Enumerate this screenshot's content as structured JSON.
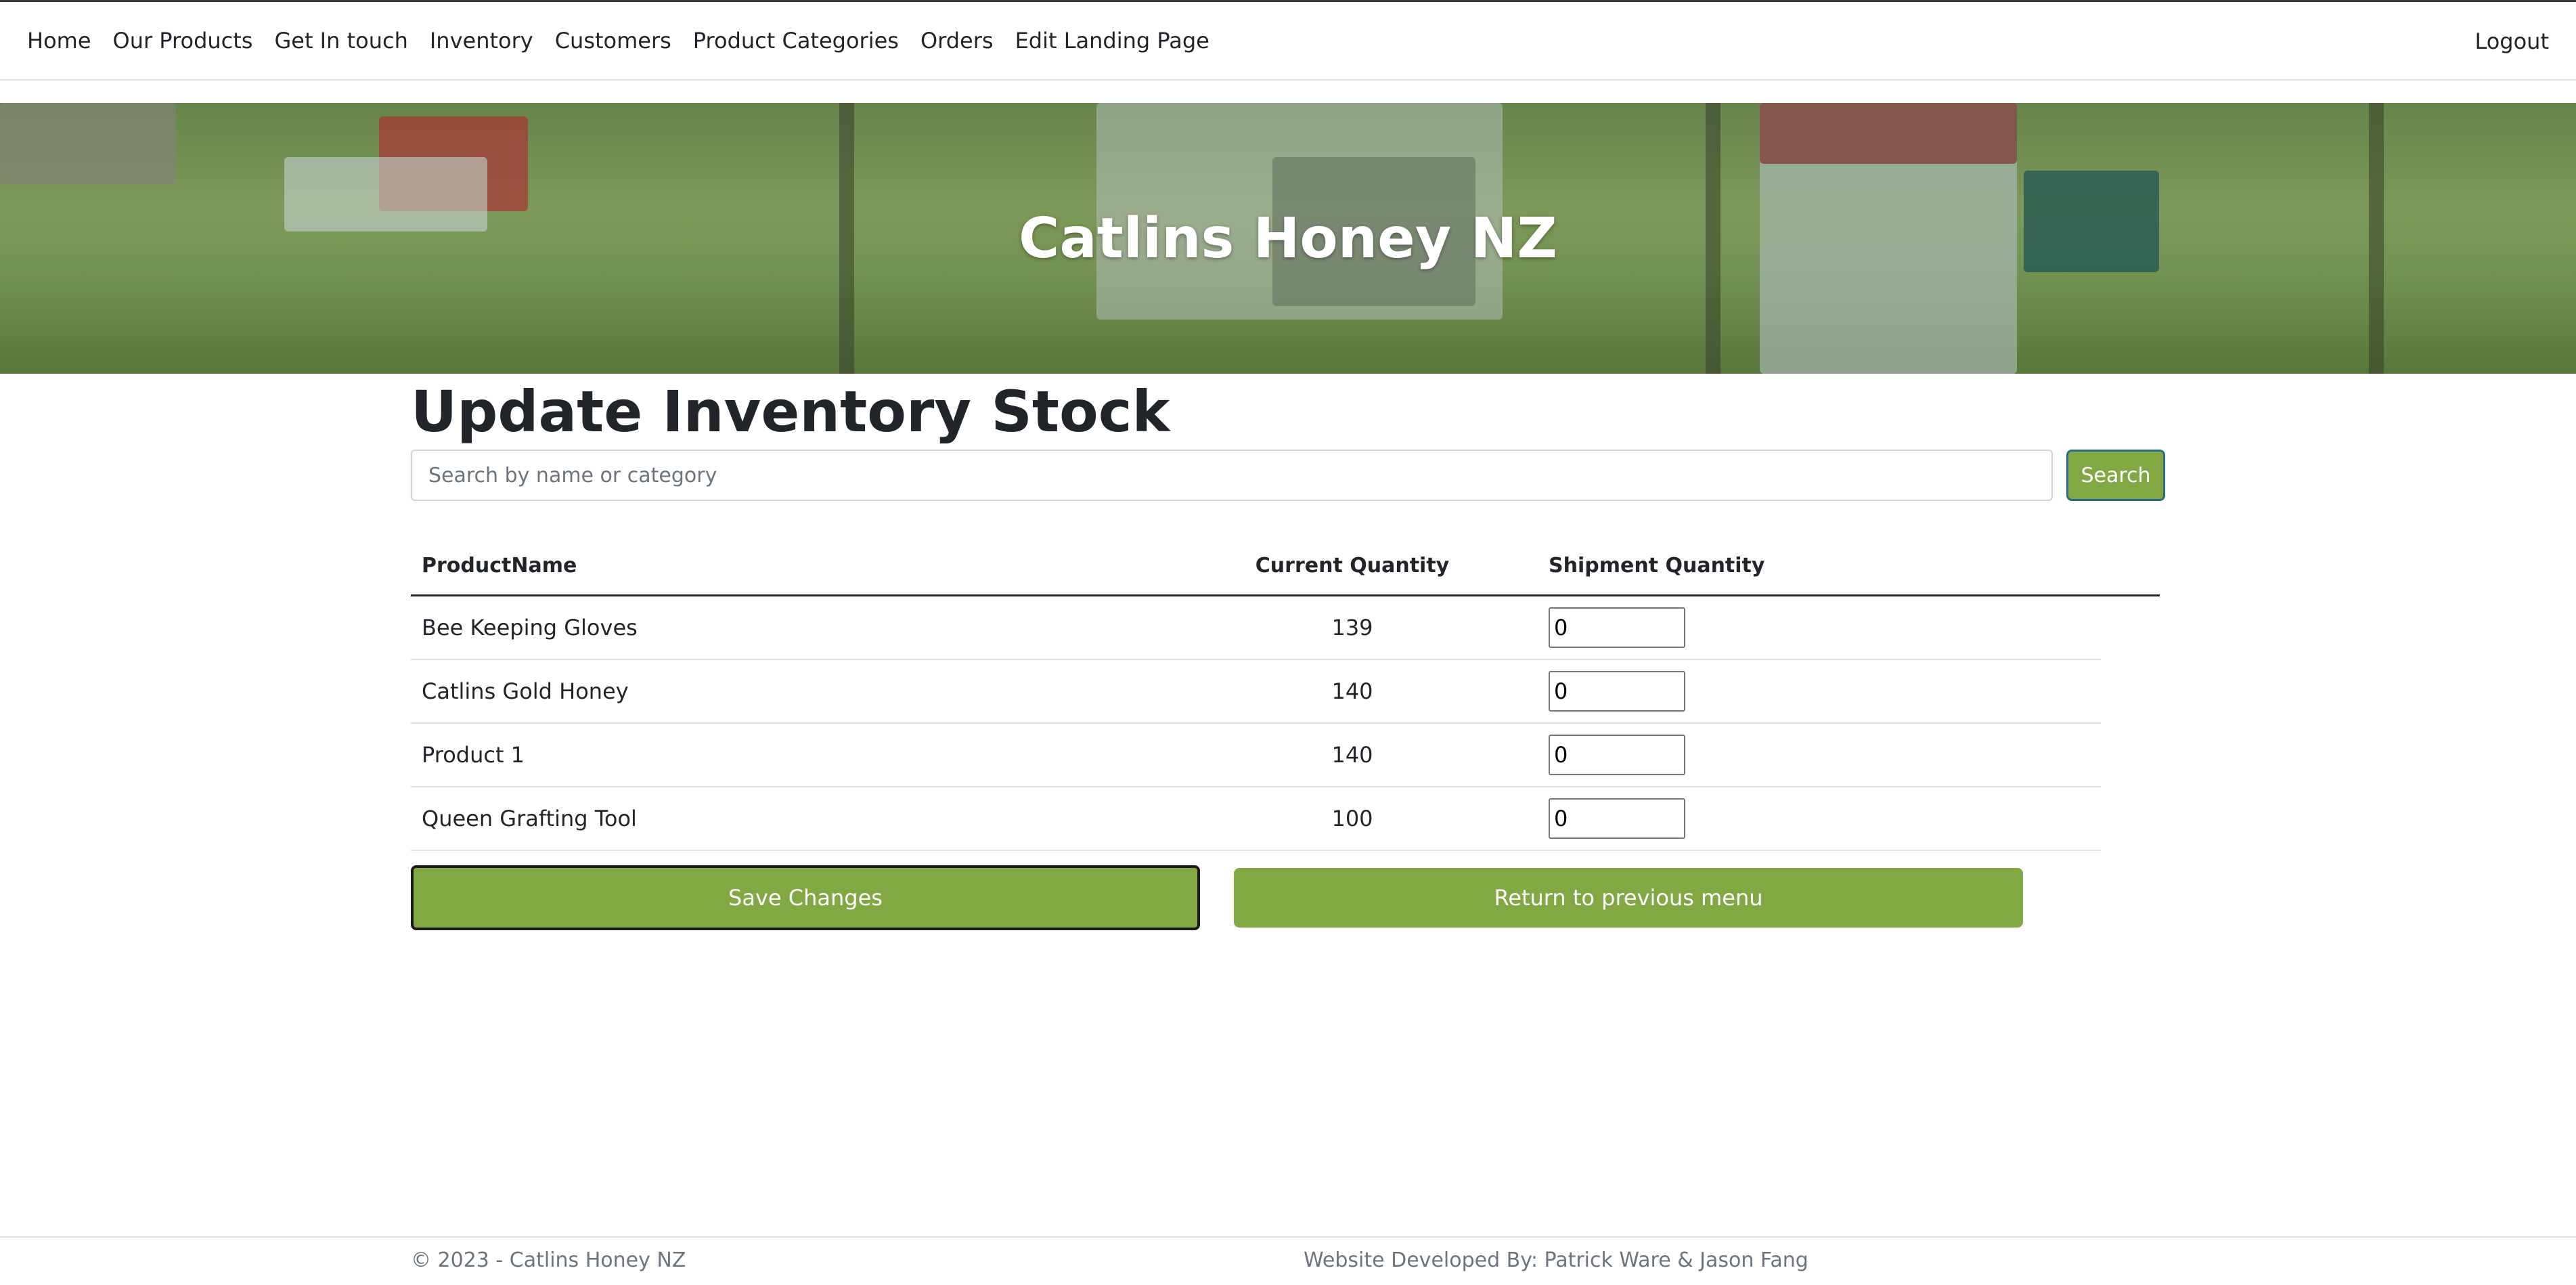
{
  "nav": {
    "links": [
      "Home",
      "Our Products",
      "Get In touch",
      "Inventory",
      "Customers",
      "Product Categories",
      "Orders",
      "Edit Landing Page"
    ],
    "logout": "Logout"
  },
  "hero": {
    "title": "Catlins Honey NZ"
  },
  "page": {
    "title": "Update Inventory Stock"
  },
  "search": {
    "placeholder": "Search by name or category",
    "value": "",
    "button": "Search"
  },
  "table": {
    "headers": {
      "name": "ProductName",
      "current": "Current Quantity",
      "shipment": "Shipment Quantity"
    },
    "rows": [
      {
        "name": "Bee Keeping Gloves",
        "current": "139",
        "shipment": "0"
      },
      {
        "name": "Catlins Gold Honey",
        "current": "140",
        "shipment": "0"
      },
      {
        "name": "Product 1",
        "current": "140",
        "shipment": "0"
      },
      {
        "name": "Queen Grafting Tool",
        "current": "100",
        "shipment": "0"
      }
    ]
  },
  "buttons": {
    "save": "Save Changes",
    "return": "Return to previous menu"
  },
  "footer": {
    "copyright": "© 2023 - Catlins Honey NZ",
    "developer": "Website Developed By: Patrick Ware & Jason Fang"
  },
  "colors": {
    "accent": "#82a843",
    "text": "#212529",
    "muted": "#6c757d"
  }
}
